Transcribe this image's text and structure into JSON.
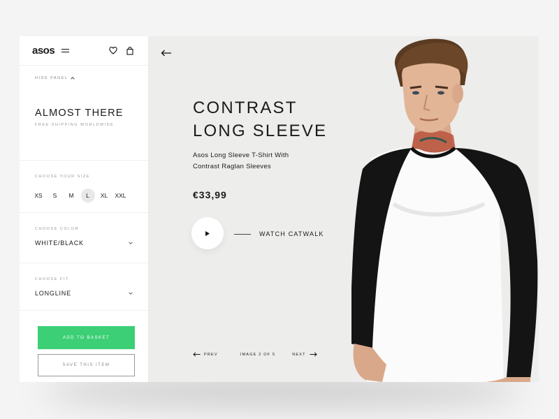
{
  "panel": {
    "logo": "asos",
    "hide_panel": "HIDE PANEL",
    "title": "ALMOST THERE",
    "subtitle": "FREE SHIPPING WORLDWIDE",
    "size_label": "CHOOSE YOUR SIZE",
    "sizes": [
      "XS",
      "S",
      "M",
      "L",
      "XL",
      "XXL"
    ],
    "selected_size": "L",
    "color_label": "CHOOSE COLOR",
    "color_value": "WHITE/BLACK",
    "fit_label": "CHOOSE FIT",
    "fit_value": "LONGLINE",
    "add_to_basket": "ADD TO BASKET",
    "save_item": "SAVE THIS ITEM"
  },
  "product": {
    "title_line1": "CONTRAST",
    "title_line2": "LONG SLEEVE",
    "desc_line1": "Asos Long Sleeve T-Shirt With",
    "desc_line2": "Contrast Raglan Sleeves",
    "price": "€33,99",
    "watch": "WATCH CATWALK"
  },
  "pager": {
    "prev": "PREV",
    "count": "IMAGE 2 OF 5",
    "next": "NEXT"
  },
  "colors": {
    "accent_green": "#3ccf76",
    "main_bg": "#ededec",
    "panel_bg": "#ffffff"
  },
  "icons": [
    "menu-icon",
    "heart-icon",
    "bag-icon",
    "chevron-up-icon",
    "chevron-down-icon",
    "arrow-left-icon",
    "play-icon",
    "arrow-right-icon"
  ]
}
